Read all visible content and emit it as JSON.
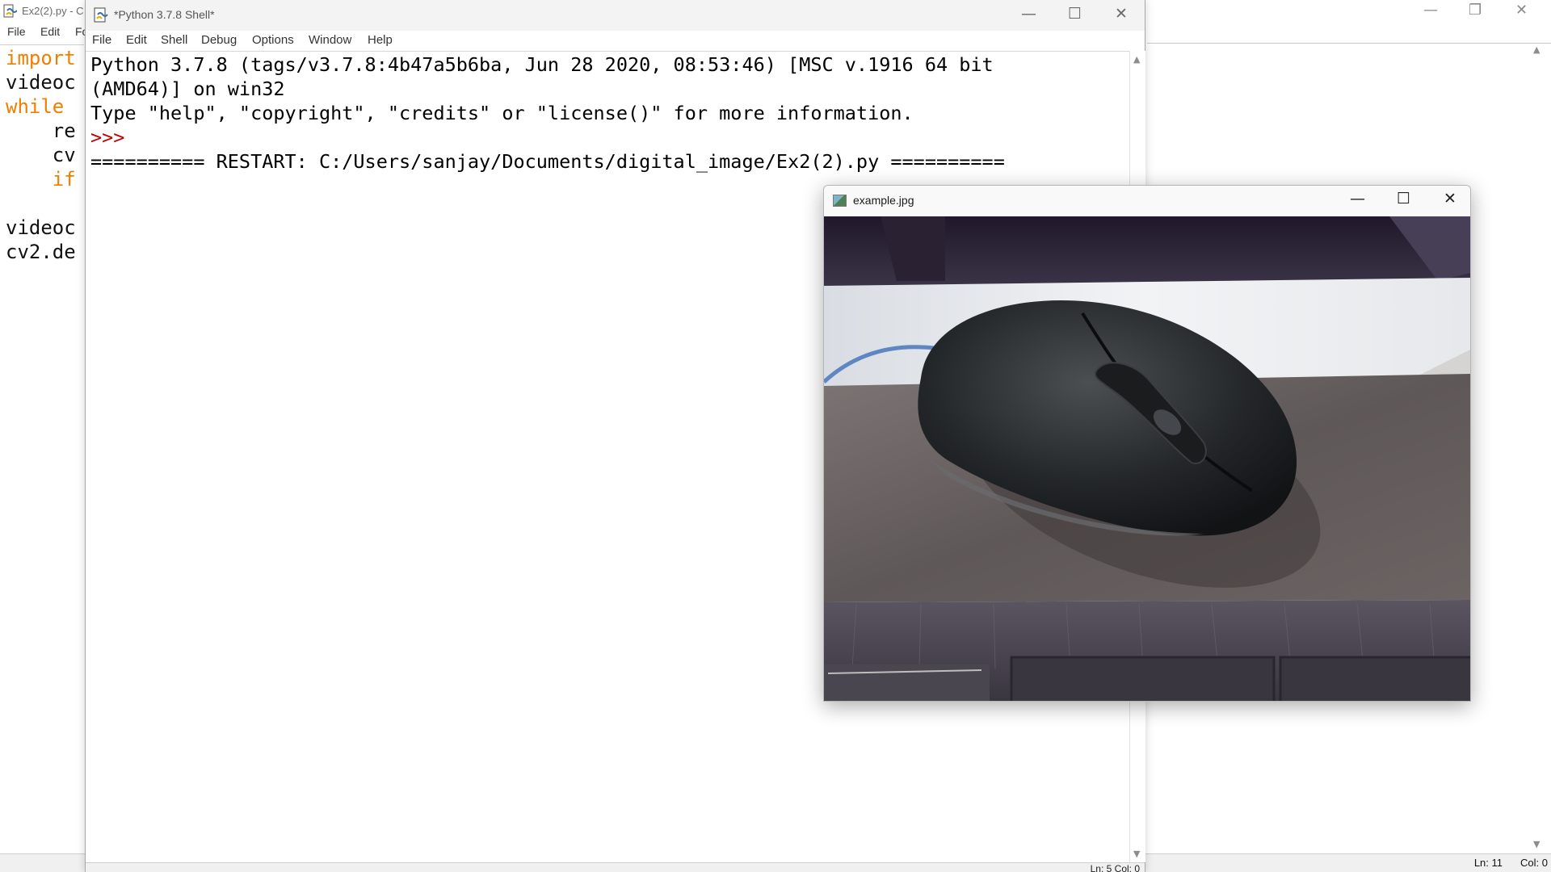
{
  "editor": {
    "title": "Ex2(2).py - C",
    "menu": [
      "File",
      "Edit",
      "Fo"
    ],
    "code_lines": [
      {
        "text": "import",
        "keyword": true
      },
      {
        "text": "videoc",
        "keyword": false
      },
      {
        "text": "while ",
        "keyword": true
      },
      {
        "text": "    re",
        "keyword": false
      },
      {
        "text": "    cv",
        "keyword": false
      },
      {
        "text": "    if",
        "keyword": true
      },
      {
        "text": "",
        "keyword": false
      },
      {
        "text": "videoc",
        "keyword": false
      },
      {
        "text": "cv2.de",
        "keyword": false
      }
    ],
    "status": {
      "line": "Ln: 11",
      "col": "Col: 0"
    }
  },
  "shell": {
    "title": "*Python 3.7.8 Shell*",
    "menu": [
      "File",
      "Edit",
      "Shell",
      "Debug",
      "Options",
      "Window",
      "Help"
    ],
    "lines": [
      "Python 3.7.8 (tags/v3.7.8:4b47a5b6ba, Jun 28 2020, 08:53:46) [MSC v.1916 64 bit",
      "(AMD64)] on win32",
      "Type \"help\", \"copyright\", \"credits\" or \"license()\" for more information."
    ],
    "prompt": ">>> ",
    "restart_line": "========== RESTART: C:/Users/sanjay/Documents/digital_image/Ex2(2).py ==========",
    "status": "Ln: 5  Col: 0"
  },
  "viewer": {
    "title": "example.jpg",
    "image_subject": "webcam photo of black computer mouse on desk"
  },
  "icons": {
    "minimize": "minimize-icon",
    "maximize": "maximize-icon",
    "close": "close-icon"
  },
  "colors": {
    "keyword": "#f07f00",
    "prompt": "#c00000"
  }
}
